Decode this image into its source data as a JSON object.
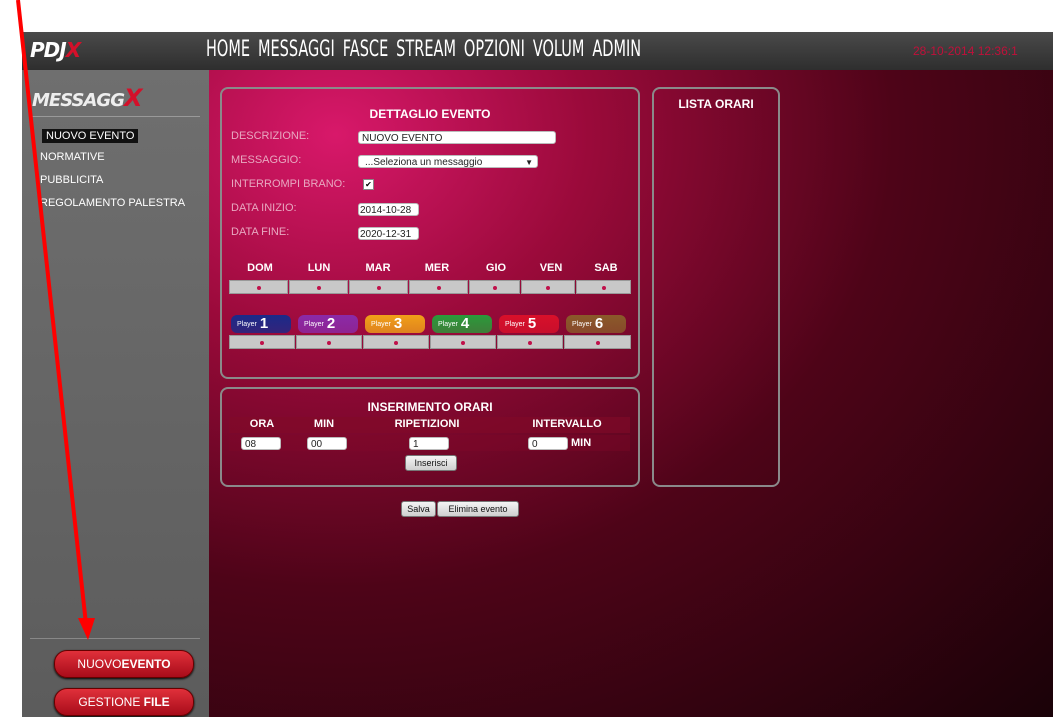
{
  "topbar": {
    "logo_main": "PDJ",
    "logo_x": "X",
    "nav": [
      "HOME",
      "MESSAGGI",
      "FASCE",
      "STREAM",
      "OPZIONI",
      "VOLUM",
      "ADMIN"
    ],
    "datetime": "28-10-2014 12:36:1"
  },
  "sidebar": {
    "logo_main": "MESSAGG",
    "logo_x": "X",
    "items": [
      {
        "label": "NUOVO EVENTO",
        "active": true
      },
      {
        "label": "NORMATIVE"
      },
      {
        "label": "PUBBLICITA"
      },
      {
        "label": "REGOLAMENTO PALESTRA"
      }
    ],
    "btn_new_prefix": "NUOVO",
    "btn_new_bold": "EVENTO",
    "btn_files_prefix": "GESTIONE ",
    "btn_files_bold": "FILE"
  },
  "dettaglio": {
    "title": "DETTAGLIO EVENTO",
    "descrizione_label": "DESCRIZIONE:",
    "descrizione_value": "NUOVO EVENTO",
    "messaggio_label": "MESSAGGIO:",
    "messaggio_value": "...Seleziona un messaggio",
    "interrompi_label": "INTERROMPI BRANO:",
    "interrompi_checked": true,
    "data_inizio_label": "DATA INIZIO:",
    "data_inizio_value": "2014-10-28",
    "data_fine_label": "DATA FINE:",
    "data_fine_value": "2020-12-31",
    "days": [
      "DOM",
      "LUN",
      "MAR",
      "MER",
      "GIO",
      "VEN",
      "SAB"
    ],
    "players": [
      {
        "label": "Player",
        "num": "1",
        "color": "#1a2a8a"
      },
      {
        "label": "Player",
        "num": "2",
        "color": "#8a2aa8"
      },
      {
        "label": "Player",
        "num": "3",
        "color": "#f0a018"
      },
      {
        "label": "Player",
        "num": "4",
        "color": "#2a9a3a"
      },
      {
        "label": "Player",
        "num": "5",
        "color": "#d8102a"
      },
      {
        "label": "Player",
        "num": "6",
        "color": "#8a5a2a"
      }
    ]
  },
  "inserimento": {
    "title": "INSERIMENTO ORARI",
    "col_ora": "ORA",
    "col_min": "MIN",
    "col_ripetizioni": "RIPETIZIONI",
    "col_intervallo": "INTERVALLO",
    "ora_value": "08",
    "min_value": "00",
    "ripetizioni_value": "1",
    "intervallo_value": "0",
    "intervallo_unit": "MIN",
    "inserisci_label": "Inserisci"
  },
  "lista": {
    "title": "LISTA ORARI"
  },
  "actions": {
    "salva_label": "Salva",
    "elimina_label": "Elimina evento"
  },
  "colors": {
    "accent": "#d4102a",
    "annotation_arrow": "#ff0000"
  }
}
